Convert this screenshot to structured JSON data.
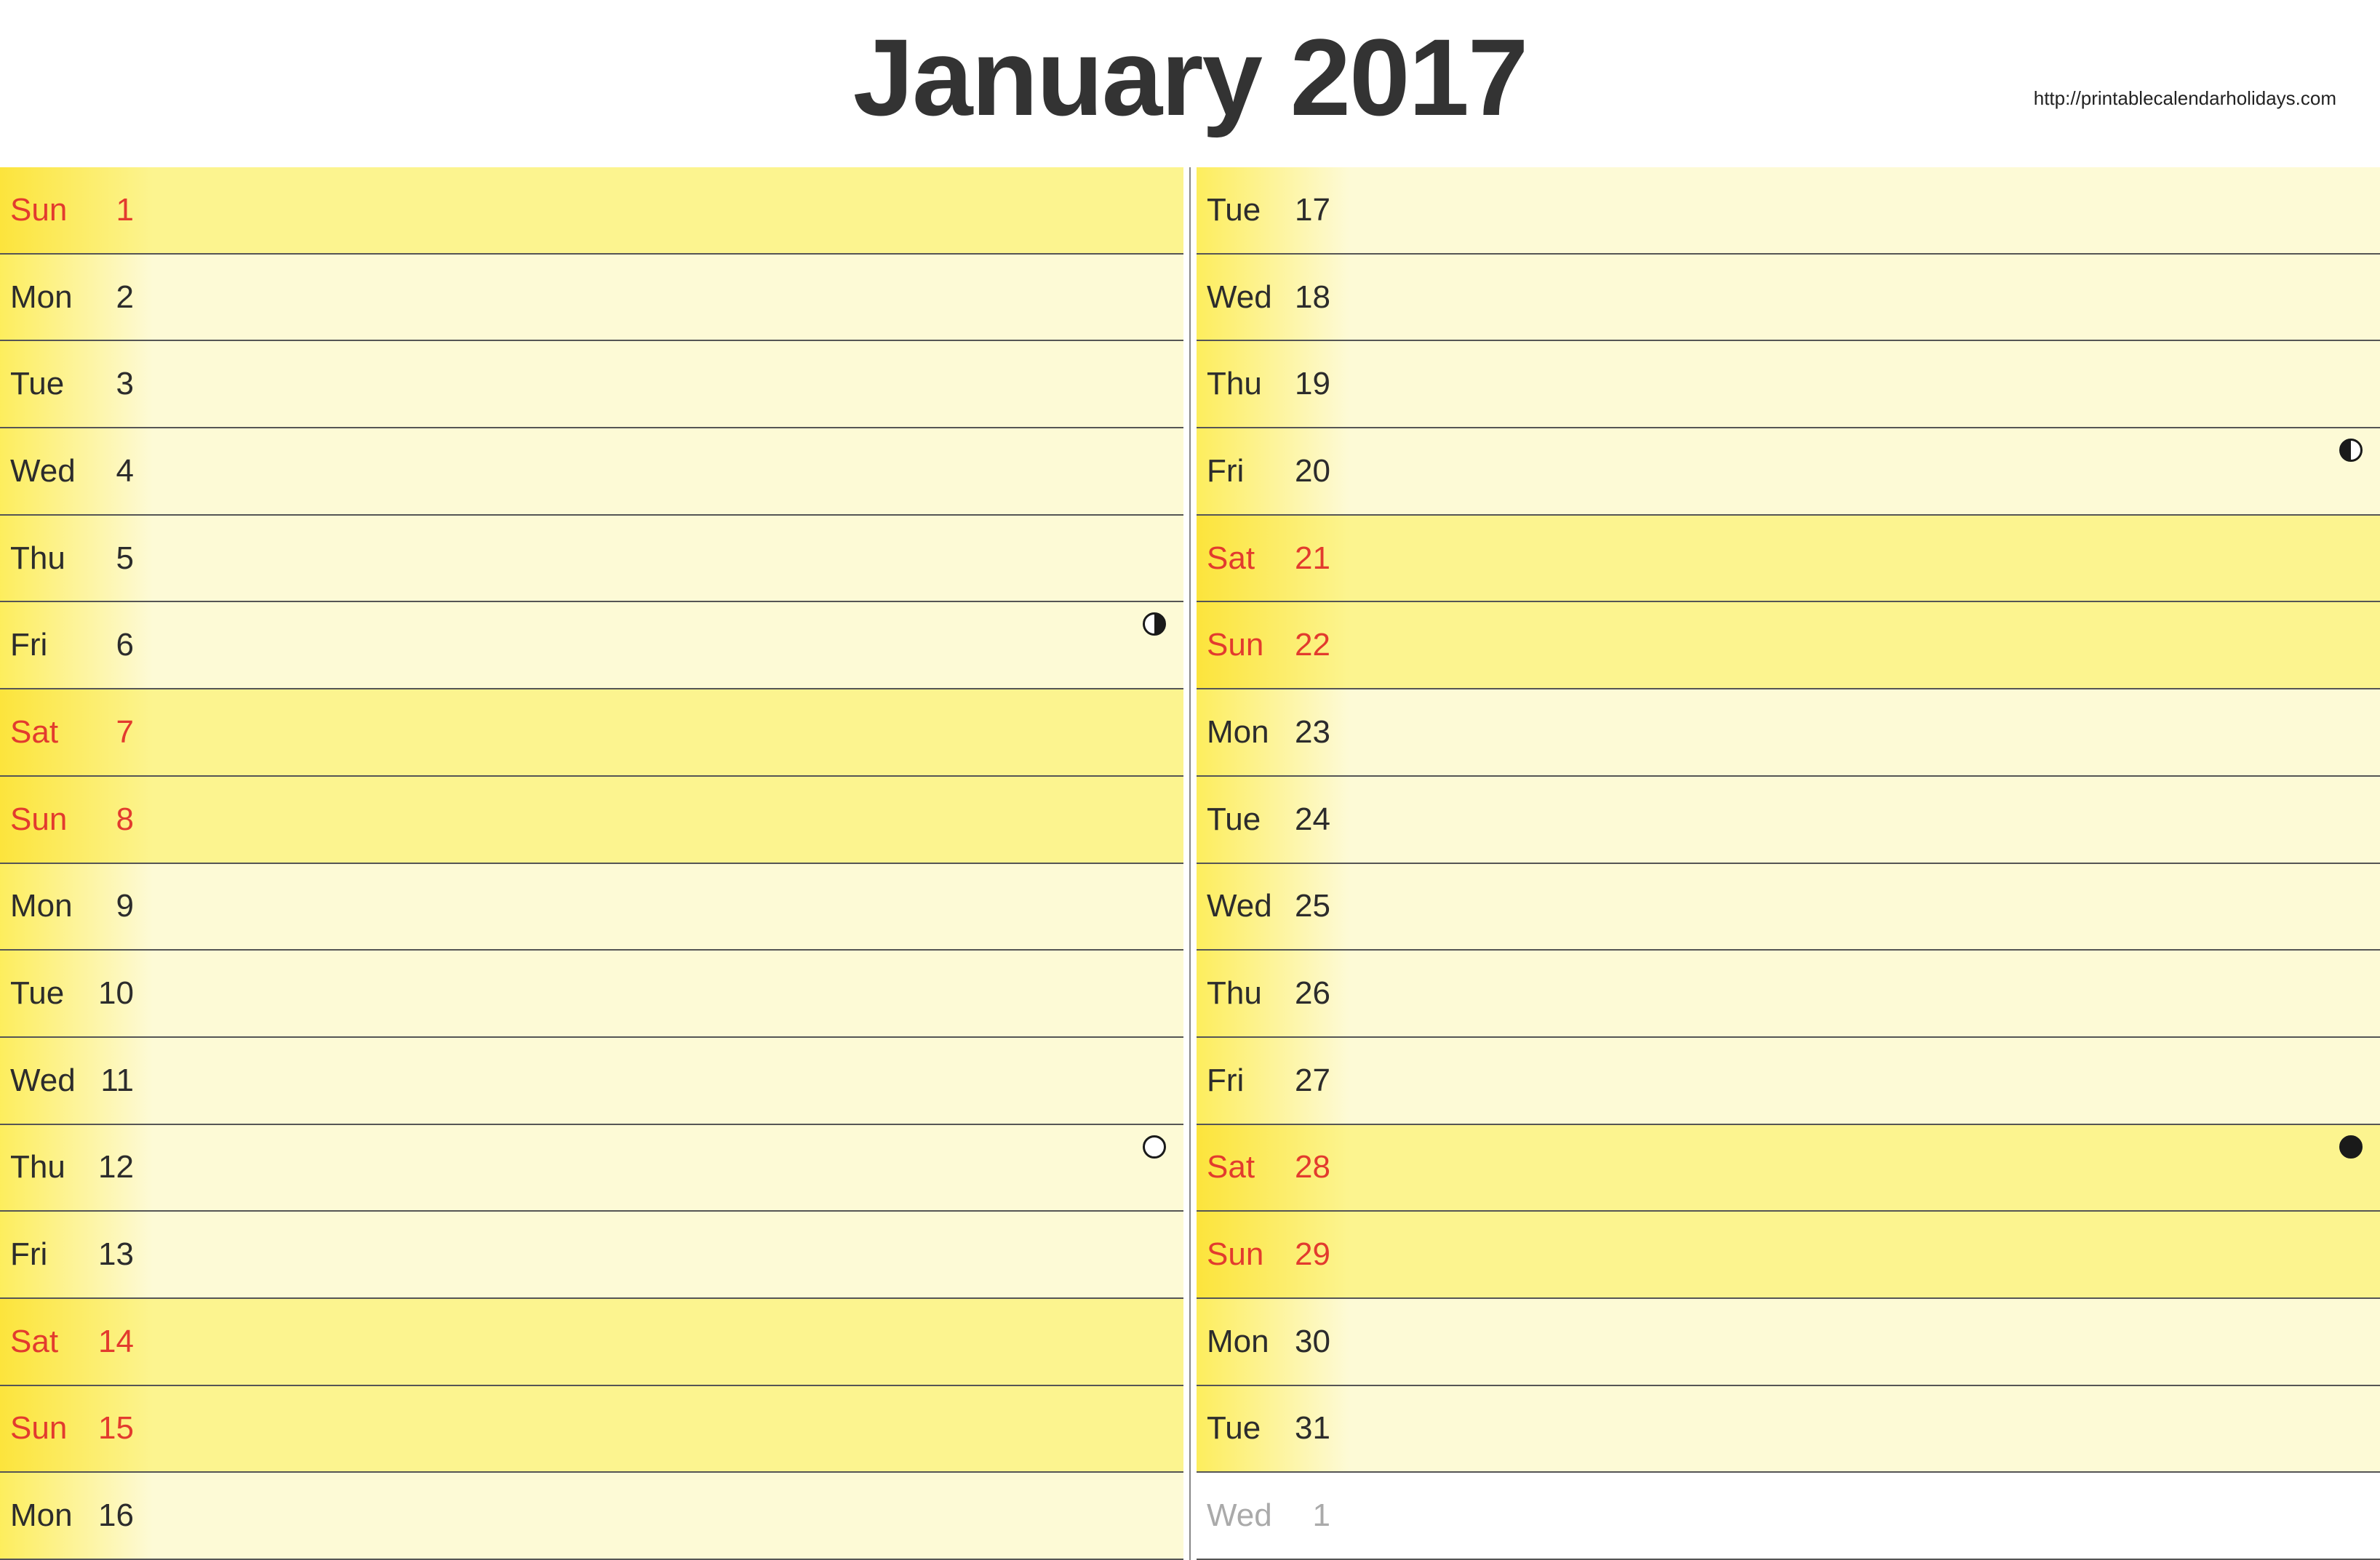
{
  "header": {
    "title": "January 2017",
    "source_url": "http://printablecalendarholidays.com"
  },
  "colors": {
    "weekday_bg": "#fdfad6",
    "weekend_bg": "#fcf48f",
    "weekend_text": "#e23b2e",
    "other_month_text": "#aaaaaa",
    "title_text": "#333333"
  },
  "moon_phases": {
    "full": "full",
    "first_quarter": "first-quarter",
    "last_quarter": "last-quarter",
    "new": "new"
  },
  "columns": [
    {
      "rows": [
        {
          "dow": "Sun",
          "num": "1",
          "weekend": true,
          "other_month": false,
          "moon": null
        },
        {
          "dow": "Mon",
          "num": "2",
          "weekend": false,
          "other_month": false,
          "moon": null
        },
        {
          "dow": "Tue",
          "num": "3",
          "weekend": false,
          "other_month": false,
          "moon": null
        },
        {
          "dow": "Wed",
          "num": "4",
          "weekend": false,
          "other_month": false,
          "moon": null
        },
        {
          "dow": "Thu",
          "num": "5",
          "weekend": false,
          "other_month": false,
          "moon": null
        },
        {
          "dow": "Fri",
          "num": "6",
          "weekend": false,
          "other_month": false,
          "moon": "first-quarter"
        },
        {
          "dow": "Sat",
          "num": "7",
          "weekend": true,
          "other_month": false,
          "moon": null
        },
        {
          "dow": "Sun",
          "num": "8",
          "weekend": true,
          "other_month": false,
          "moon": null
        },
        {
          "dow": "Mon",
          "num": "9",
          "weekend": false,
          "other_month": false,
          "moon": null
        },
        {
          "dow": "Tue",
          "num": "10",
          "weekend": false,
          "other_month": false,
          "moon": null
        },
        {
          "dow": "Wed",
          "num": "11",
          "weekend": false,
          "other_month": false,
          "moon": null
        },
        {
          "dow": "Thu",
          "num": "12",
          "weekend": false,
          "other_month": false,
          "moon": "full"
        },
        {
          "dow": "Fri",
          "num": "13",
          "weekend": false,
          "other_month": false,
          "moon": null
        },
        {
          "dow": "Sat",
          "num": "14",
          "weekend": true,
          "other_month": false,
          "moon": null
        },
        {
          "dow": "Sun",
          "num": "15",
          "weekend": true,
          "other_month": false,
          "moon": null
        },
        {
          "dow": "Mon",
          "num": "16",
          "weekend": false,
          "other_month": false,
          "moon": null
        }
      ]
    },
    {
      "rows": [
        {
          "dow": "Tue",
          "num": "17",
          "weekend": false,
          "other_month": false,
          "moon": null
        },
        {
          "dow": "Wed",
          "num": "18",
          "weekend": false,
          "other_month": false,
          "moon": null
        },
        {
          "dow": "Thu",
          "num": "19",
          "weekend": false,
          "other_month": false,
          "moon": null
        },
        {
          "dow": "Fri",
          "num": "20",
          "weekend": false,
          "other_month": false,
          "moon": "last-quarter"
        },
        {
          "dow": "Sat",
          "num": "21",
          "weekend": true,
          "other_month": false,
          "moon": null
        },
        {
          "dow": "Sun",
          "num": "22",
          "weekend": true,
          "other_month": false,
          "moon": null
        },
        {
          "dow": "Mon",
          "num": "23",
          "weekend": false,
          "other_month": false,
          "moon": null
        },
        {
          "dow": "Tue",
          "num": "24",
          "weekend": false,
          "other_month": false,
          "moon": null
        },
        {
          "dow": "Wed",
          "num": "25",
          "weekend": false,
          "other_month": false,
          "moon": null
        },
        {
          "dow": "Thu",
          "num": "26",
          "weekend": false,
          "other_month": false,
          "moon": null
        },
        {
          "dow": "Fri",
          "num": "27",
          "weekend": false,
          "other_month": false,
          "moon": null
        },
        {
          "dow": "Sat",
          "num": "28",
          "weekend": true,
          "other_month": false,
          "moon": "new"
        },
        {
          "dow": "Sun",
          "num": "29",
          "weekend": true,
          "other_month": false,
          "moon": null
        },
        {
          "dow": "Mon",
          "num": "30",
          "weekend": false,
          "other_month": false,
          "moon": null
        },
        {
          "dow": "Tue",
          "num": "31",
          "weekend": false,
          "other_month": false,
          "moon": null
        },
        {
          "dow": "Wed",
          "num": "1",
          "weekend": false,
          "other_month": true,
          "moon": null
        }
      ]
    }
  ]
}
